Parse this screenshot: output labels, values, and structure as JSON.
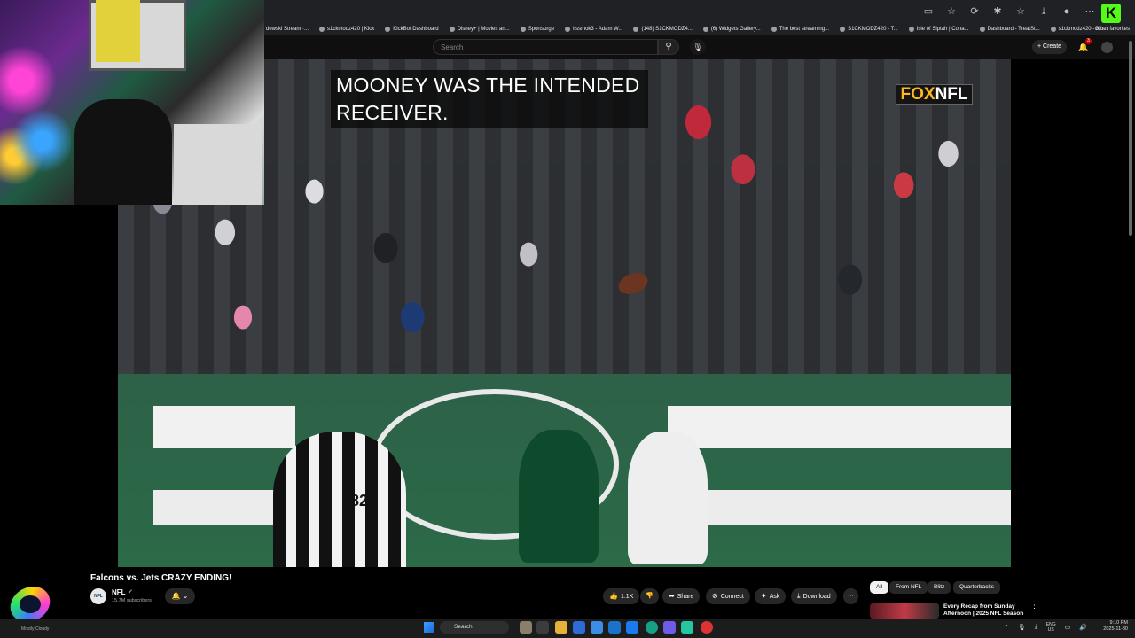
{
  "browser": {
    "bookmarks": [
      "dewski Stream ·...",
      "s1ckmodz420 | Kick",
      "KickBot Dashboard",
      "Disney+ | Movies an...",
      "Sportsurge",
      "itssmok3 - Adam W...",
      "(148) S1CKMODZ4...",
      "(6) Widgets Gallery...",
      "The best streaming...",
      "S1CKMODZ420 - T...",
      "Isle of Siptah | Cona...",
      "Dashboard - TreatSt...",
      "s1ckmodz420 - Kic..."
    ],
    "other_favorites": "Other favorites",
    "k_badge": "K"
  },
  "masthead": {
    "search_placeholder": "Search",
    "search_icon": "⚲",
    "mic_icon": "🎙",
    "create_label": "+ Create",
    "bell_icon": "🔔",
    "notification_count": "3"
  },
  "video": {
    "caption": "MOONEY WAS THE INTENDED RECEIVER.",
    "network_logo_fox": "FOX",
    "network_logo_nfl": "NFL",
    "ref_number": "82"
  },
  "info": {
    "title": "Falcons vs. Jets CRAZY ENDING!",
    "channel_avatar_text": "NFL",
    "channel_name": "NFL",
    "verified_icon": "✔",
    "subscribers": "15.7M subscribers",
    "bell_label": "🔔 ⌄",
    "actions": {
      "like": "1.1K",
      "dislike": "",
      "share": "Share",
      "connect": "Connect",
      "ask": "Ask",
      "download": "Download",
      "more": "···"
    }
  },
  "chips": [
    "All",
    "From NFL",
    "Blitz",
    "Quarterbacks"
  ],
  "recommendation": {
    "title": "Every Recap from Sunday Afternoon | 2025 NFL Season"
  },
  "streamer": {
    "name": "Mostly Cloudy"
  },
  "taskbar": {
    "search_label": "Search",
    "lang_top": "ENG",
    "lang_bottom": "US",
    "time": "9:10 PM",
    "date": "2025-11-30"
  }
}
